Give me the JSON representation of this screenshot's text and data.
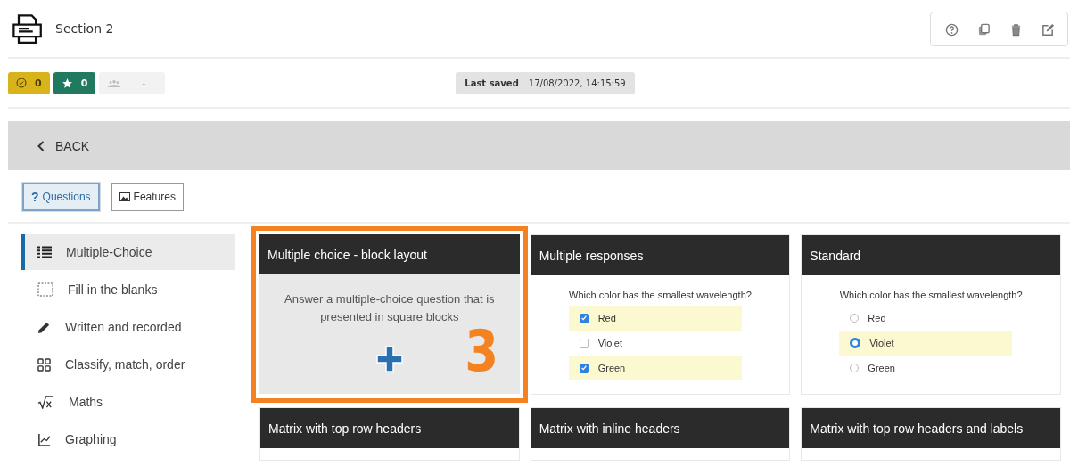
{
  "header": {
    "title": "Section 2"
  },
  "status": {
    "review_count": "0",
    "star_count": "0",
    "group_value": "-",
    "last_saved_label": "Last saved",
    "last_saved_value": "17/08/2022, 14:15:59"
  },
  "back_button": {
    "label": "BACK"
  },
  "tabs": [
    {
      "label": "Questions",
      "icon": "?",
      "selected": true
    },
    {
      "label": "Features",
      "selected": false
    }
  ],
  "sidebar": {
    "items": [
      {
        "label": "Multiple-Choice",
        "selected": true
      },
      {
        "label": "Fill in the blanks",
        "selected": false
      },
      {
        "label": "Written and recorded",
        "selected": false
      },
      {
        "label": "Classify, match, order",
        "selected": false
      },
      {
        "label": "Maths",
        "selected": false
      },
      {
        "label": "Graphing",
        "selected": false
      }
    ]
  },
  "cards": [
    {
      "title": "Multiple choice - block layout",
      "kind": "description",
      "highlighted": true,
      "annotation": "3",
      "description": "Answer a multiple-choice question that is presented in square blocks"
    },
    {
      "title": "Multiple responses",
      "kind": "checkbox",
      "highlighted": false,
      "question": "Which color has the smallest wavelength?",
      "options": [
        {
          "label": "Red",
          "checked": true
        },
        {
          "label": "Violet",
          "checked": false
        },
        {
          "label": "Green",
          "checked": true
        }
      ]
    },
    {
      "title": "Standard",
      "kind": "radio",
      "highlighted": false,
      "question": "Which color has the smallest wavelength?",
      "options": [
        {
          "label": "Red",
          "checked": false
        },
        {
          "label": "Violet",
          "checked": true
        },
        {
          "label": "Green",
          "checked": false
        }
      ]
    },
    {
      "title": "Matrix with top row headers",
      "kind": "header-only",
      "highlighted": false
    },
    {
      "title": "Matrix with inline headers",
      "kind": "header-only",
      "highlighted": false
    },
    {
      "title": "Matrix with top row headers and labels",
      "kind": "header-only",
      "highlighted": false
    }
  ]
}
